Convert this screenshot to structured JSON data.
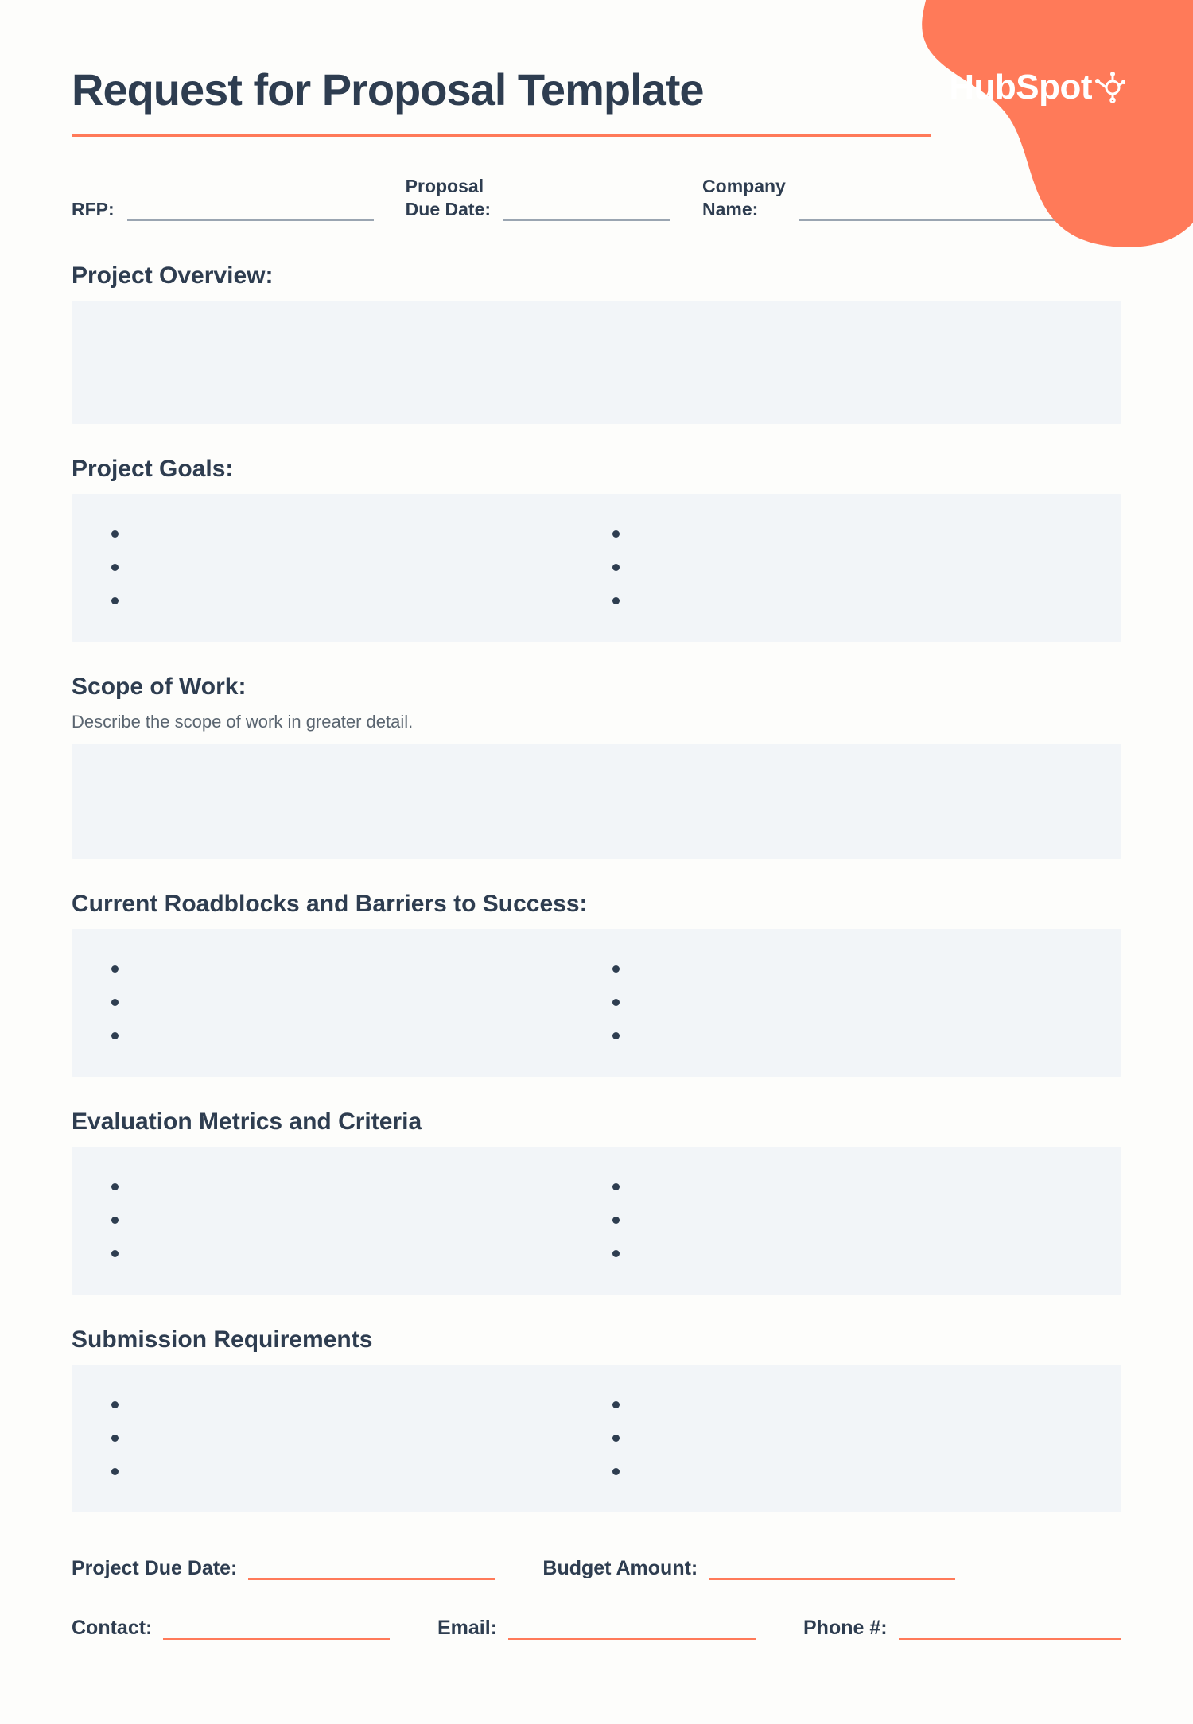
{
  "brand": {
    "name": "HubSpot"
  },
  "title": "Request for Proposal Template",
  "meta": {
    "rfp": {
      "label": "RFP:",
      "value": ""
    },
    "due": {
      "label": "Proposal\nDue Date:",
      "value": ""
    },
    "company": {
      "label": "Company\nName:",
      "value": ""
    }
  },
  "sections": {
    "overview": {
      "title": "Project Overview:",
      "value": ""
    },
    "goals": {
      "title": "Project Goals:",
      "left": [
        "",
        "",
        ""
      ],
      "right": [
        "",
        "",
        ""
      ]
    },
    "scope": {
      "title": "Scope of Work:",
      "desc": "Describe the scope of work in greater detail.",
      "value": ""
    },
    "roadblocks": {
      "title": "Current Roadblocks and Barriers to Success:",
      "left": [
        "",
        "",
        ""
      ],
      "right": [
        "",
        "",
        ""
      ]
    },
    "metrics": {
      "title": "Evaluation Metrics and Criteria",
      "left": [
        "",
        "",
        ""
      ],
      "right": [
        "",
        "",
        ""
      ]
    },
    "submission": {
      "title": "Submission Requirements",
      "left": [
        "",
        "",
        ""
      ],
      "right": [
        "",
        "",
        ""
      ]
    }
  },
  "footer": {
    "projectDue": {
      "label": "Project Due Date:",
      "value": ""
    },
    "budget": {
      "label": "Budget Amount:",
      "value": ""
    },
    "contact": {
      "label": "Contact:",
      "value": ""
    },
    "email": {
      "label": "Email:",
      "value": ""
    },
    "phone": {
      "label": "Phone #:",
      "value": ""
    }
  }
}
